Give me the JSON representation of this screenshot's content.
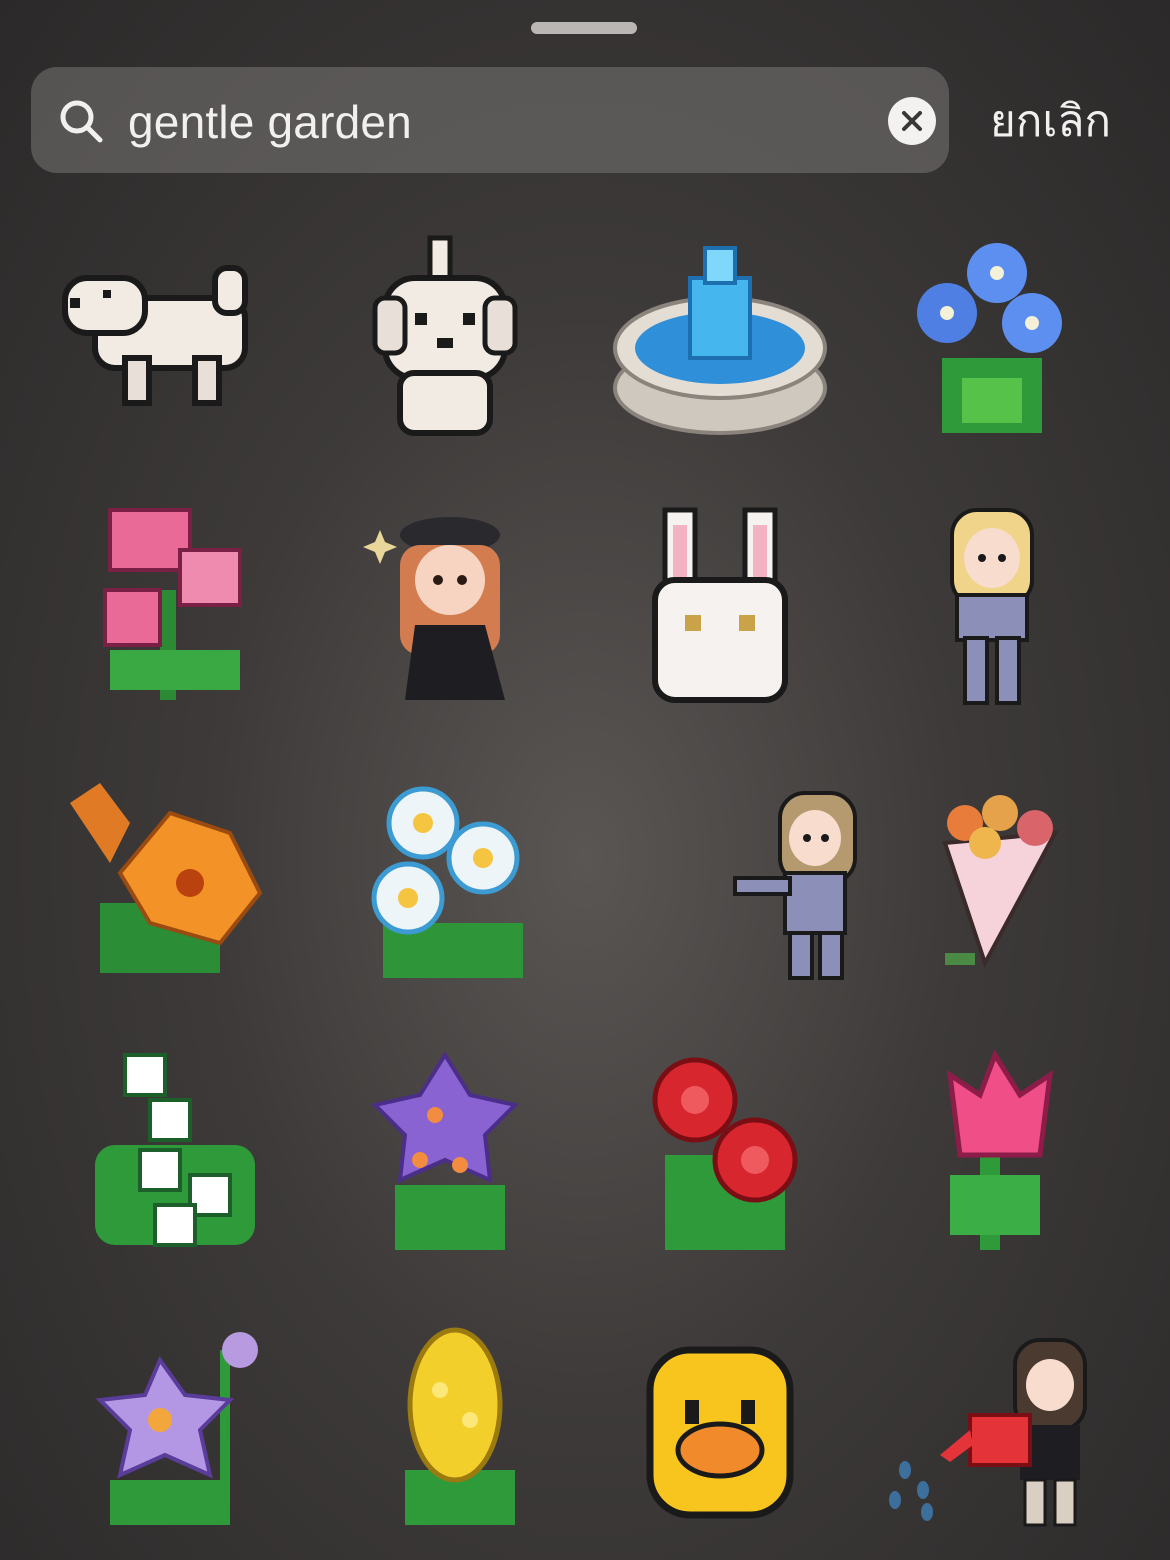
{
  "search": {
    "value": "gentle garden",
    "cancel_label": "ยกเลิก"
  },
  "stickers": [
    {
      "name": "sticker-white-dog-side"
    },
    {
      "name": "sticker-white-dog-front"
    },
    {
      "name": "sticker-blue-fountain"
    },
    {
      "name": "sticker-blue-flowers"
    },
    {
      "name": "sticker-pink-flowers"
    },
    {
      "name": "sticker-girl-beret"
    },
    {
      "name": "sticker-white-rabbit"
    },
    {
      "name": "sticker-blonde-girl-standing"
    },
    {
      "name": "sticker-orange-lily"
    },
    {
      "name": "sticker-white-daisies"
    },
    {
      "name": "sticker-girl-waving"
    },
    {
      "name": "sticker-bouquet"
    },
    {
      "name": "sticker-lily-of-the-valley"
    },
    {
      "name": "sticker-purple-flowers"
    },
    {
      "name": "sticker-red-roses"
    },
    {
      "name": "sticker-pink-tulip"
    },
    {
      "name": "sticker-lavender-flower"
    },
    {
      "name": "sticker-yellow-hyacinth"
    },
    {
      "name": "sticker-yellow-duck"
    },
    {
      "name": "sticker-girl-watering-can"
    }
  ]
}
